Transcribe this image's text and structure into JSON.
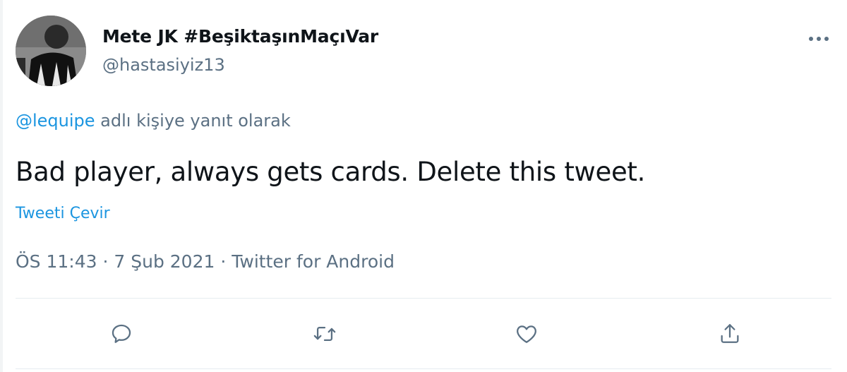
{
  "author": {
    "display_name": "Mete JK #BeşiktaşınMaçıVar",
    "handle": "@hastasiyiz13"
  },
  "reply_context": {
    "mention": "@lequipe",
    "text": " adlı kişiye yanıt olarak"
  },
  "tweet": {
    "text": "Bad player, always gets cards. Delete this tweet.",
    "translate_label": "Tweeti Çevir"
  },
  "meta": {
    "time": "ÖS 11:43",
    "separator": " · ",
    "date": "7 Şub 2021",
    "source": "Twitter for Android"
  },
  "actions": [
    "reply-icon",
    "retweet-icon",
    "like-icon",
    "share-icon"
  ],
  "colors": {
    "link": "#1b95e0",
    "secondary_text": "#5b7083",
    "primary_text": "#0f1419",
    "divider": "#e6ecf0"
  }
}
